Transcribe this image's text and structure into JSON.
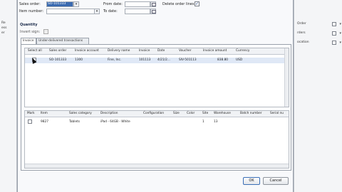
{
  "background_left": {
    "labels": [
      "Re",
      "ess",
      "er"
    ]
  },
  "background_right": {
    "items": [
      "Order",
      "rders",
      "ocation"
    ]
  },
  "form": {
    "sales_order_label": "Sales order:",
    "sales_order_value": "SO-101333",
    "item_number_label": "Item number:",
    "item_number_value": "",
    "from_date_label": "From date:",
    "to_date_label": "To date:",
    "delete_order_lines_label": "Delete order lines:",
    "delete_order_lines_checked": "✓"
  },
  "quantity": {
    "title": "Quantity",
    "invert_sign_label": "Invert sign:"
  },
  "tabs": [
    {
      "label": "Invoice"
    },
    {
      "label": "Under-delivered transactions"
    }
  ],
  "invoice_grid": {
    "columns": [
      "Select all",
      "Sales order",
      "Invoice account",
      "Delivery name",
      "Invoice",
      "Date",
      "Voucher",
      "Invoice amount",
      "Currency"
    ],
    "rows": [
      {
        "sales_order": "SO-101333",
        "invoice_account": "1300",
        "delivery_name": "Fine, Inc.",
        "invoice": "101113",
        "date": "4/21/2...",
        "voucher": "SIV-501113",
        "invoice_amount": "838.80",
        "currency": "USD"
      }
    ]
  },
  "lines_grid": {
    "columns": [
      "Mark",
      "Item",
      "Sales category",
      "Description",
      "Configuration",
      "Size",
      "Color",
      "Site",
      "Warehouse",
      "Batch number",
      "Serial nu"
    ],
    "rows": [
      {
        "item": "9827",
        "sales_category": "Tablets",
        "description": "iPad - 64GB - White",
        "configuration": "",
        "size": "",
        "color": "",
        "site": "1",
        "warehouse": "13",
        "batch": "",
        "serial": ""
      }
    ]
  },
  "buttons": {
    "ok": "OK",
    "cancel": "Cancel"
  }
}
